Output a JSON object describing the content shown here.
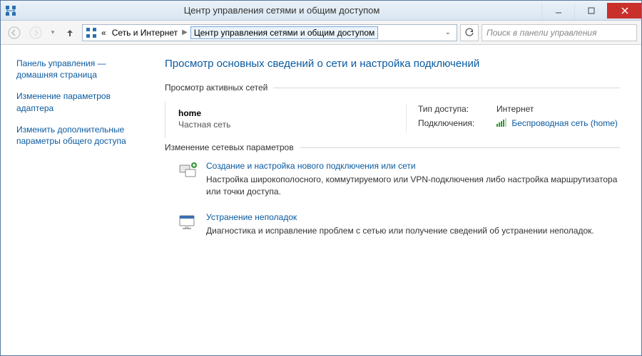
{
  "window": {
    "title": "Центр управления сетями и общим доступом"
  },
  "breadcrumb": {
    "prefix": "«",
    "parent": "Сеть и Интернет",
    "current": "Центр управления сетями и общим доступом"
  },
  "search": {
    "placeholder": "Поиск в панели управления"
  },
  "sidebar": {
    "links": [
      "Панель управления — домашняя страница",
      "Изменение параметров адаптера",
      "Изменить дополнительные параметры общего доступа"
    ]
  },
  "main": {
    "heading": "Просмотр основных сведений о сети и настройка подключений",
    "active_header": "Просмотр активных сетей",
    "change_header": "Изменение сетевых параметров",
    "network": {
      "name": "home",
      "type_label": "Частная сеть",
      "access_key": "Тип доступа:",
      "access_val": "Интернет",
      "conn_key": "Подключения:",
      "conn_link": "Беспроводная сеть (home)"
    },
    "tasks": [
      {
        "link": "Создание и настройка нового подключения или сети",
        "desc": "Настройка широкополосного, коммутируемого или VPN-подключения либо настройка маршрутизатора или точки доступа."
      },
      {
        "link": "Устранение неполадок",
        "desc": "Диагностика и исправление проблем с сетью или получение сведений об устранении неполадок."
      }
    ]
  }
}
